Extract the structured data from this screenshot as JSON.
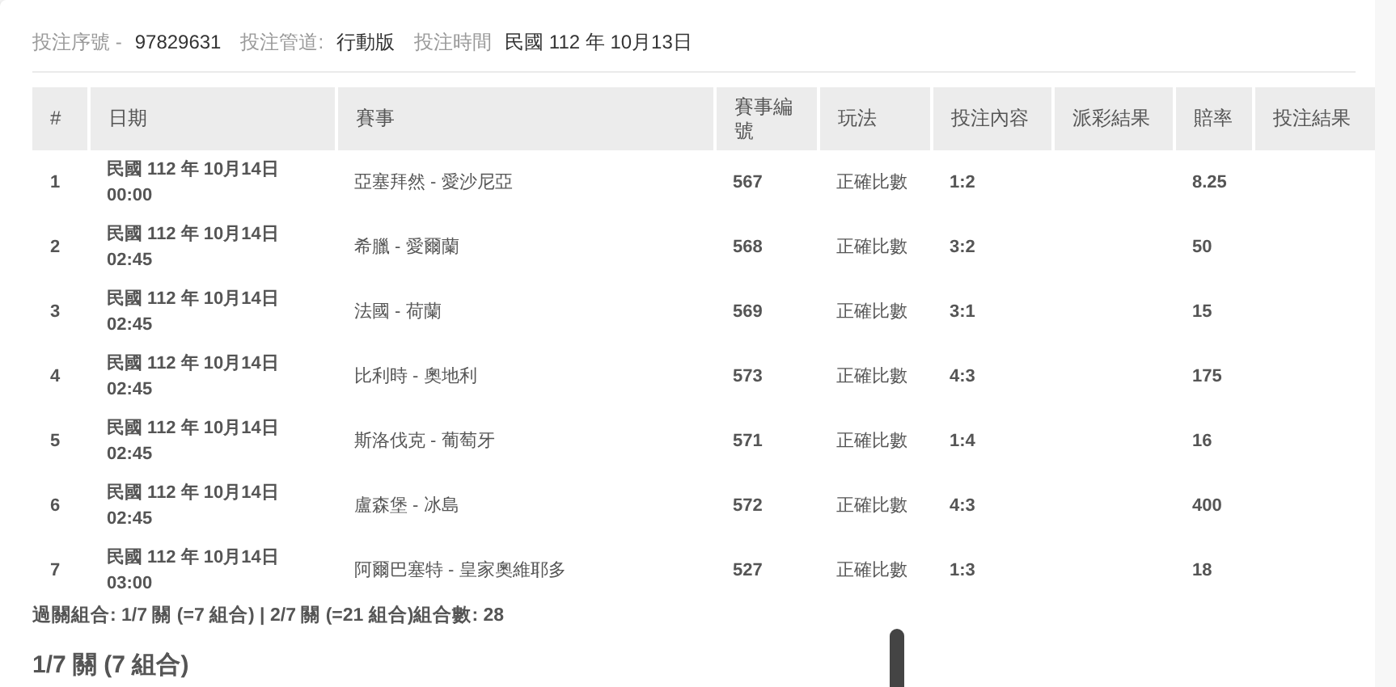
{
  "bet_info": [
    {
      "label": "投注序號 -",
      "value": "97829631"
    },
    {
      "label": "投注管道:",
      "value": "行動版"
    },
    {
      "label": "投注時間",
      "value": "民國 112 年 10月13日"
    }
  ],
  "table": {
    "columns": [
      "#",
      "日期",
      "賽事",
      "賽事編號",
      "玩法",
      "投注內容",
      "派彩結果",
      "賠率",
      "投注結果"
    ],
    "rows": [
      {
        "no": "1",
        "date": "民國 112 年 10月14日",
        "time": "00:00",
        "match": "亞塞拜然 - 愛沙尼亞",
        "match_no": "567",
        "play": "正確比數",
        "pick": "1:2",
        "odds": "8.25"
      },
      {
        "no": "2",
        "date": "民國 112 年 10月14日",
        "time": "02:45",
        "match": "希臘 - 愛爾蘭",
        "match_no": "568",
        "play": "正確比數",
        "pick": "3:2",
        "odds": "50"
      },
      {
        "no": "3",
        "date": "民國 112 年 10月14日",
        "time": "02:45",
        "match": "法國 - 荷蘭",
        "match_no": "569",
        "play": "正確比數",
        "pick": "3:1",
        "odds": "15"
      },
      {
        "no": "4",
        "date": "民國 112 年 10月14日",
        "time": "02:45",
        "match": "比利時 - 奧地利",
        "match_no": "573",
        "play": "正確比數",
        "pick": "4:3",
        "odds": "175"
      },
      {
        "no": "5",
        "date": "民國 112 年 10月14日",
        "time": "02:45",
        "match": "斯洛伐克 - 葡萄牙",
        "match_no": "571",
        "play": "正確比數",
        "pick": "1:4",
        "odds": "16"
      },
      {
        "no": "6",
        "date": "民國 112 年 10月14日",
        "time": "02:45",
        "match": "盧森堡 - 冰島",
        "match_no": "572",
        "play": "正確比數",
        "pick": "4:3",
        "odds": "400"
      },
      {
        "no": "7",
        "date": "民國 112 年 10月14日",
        "time": "03:00",
        "match": "阿爾巴塞特 - 皇家奧維耶多",
        "match_no": "527",
        "play": "正確比數",
        "pick": "1:3",
        "odds": "18"
      }
    ]
  },
  "summary": "過關組合: 1/7 關 (=7 組合) | 2/7 關 (=21 組合)組合數: 28",
  "section_title": "1/7 關 (7 組合)"
}
